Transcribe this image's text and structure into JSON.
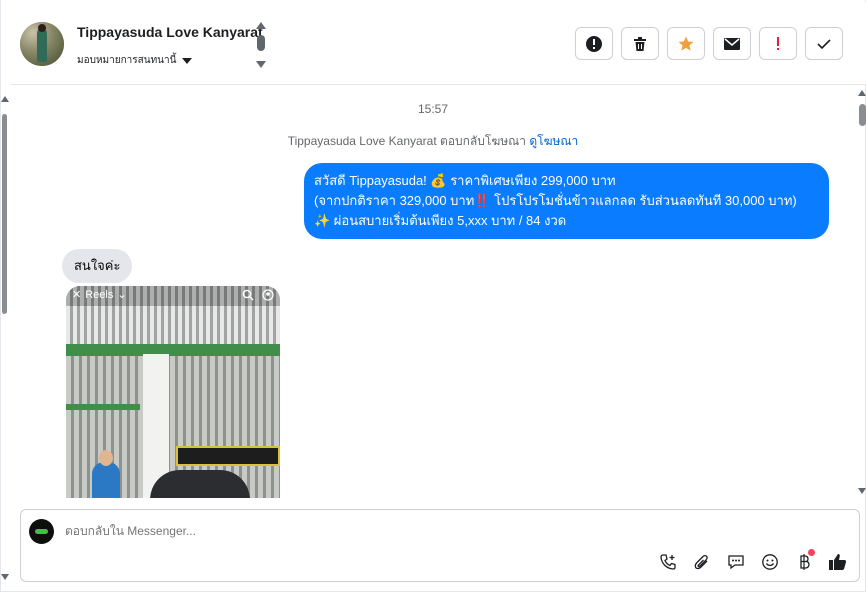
{
  "header": {
    "contact_name": "Tippayasuda Love Kanyarat",
    "assign_label": "มอบหมายการสนทนานี้",
    "actions": [
      {
        "name": "report-spam-icon",
        "label": "!"
      },
      {
        "name": "trash-icon",
        "label": "trash"
      },
      {
        "name": "star-icon",
        "label": "star"
      },
      {
        "name": "mail-icon",
        "label": "mail"
      },
      {
        "name": "mark-important-icon",
        "label": "!"
      },
      {
        "name": "check-icon",
        "label": "done"
      }
    ]
  },
  "conversation": {
    "timestamp": "15:57",
    "reply_note_prefix": "Tippayasuda Love Kanyarat ตอบกลับโฆษณา",
    "reply_note_link": "ดูโฆษณา",
    "outgoing_lines": [
      "สวัสดี Tippayasuda! 💰 ราคาพิเศษเพียง 299,000 บาท",
      "(จากปกติราคา 329,000 บาท‼️ โปรโปรโมชั่นข้าวแลกลด รับส่วนลดทันที 30,000 บาท)",
      "✨ ผ่อนสบายเริ่มต้นเพียง 5,xxx บาท / 84 งวด"
    ],
    "incoming_text": "สนใจค่ะ",
    "reel_label": "Reels"
  },
  "composer": {
    "placeholder": "ตอบกลับใน Messenger..."
  },
  "colors": {
    "accent": "#0a7cff",
    "star": "#f2a03d",
    "important": "#e41e3f"
  }
}
